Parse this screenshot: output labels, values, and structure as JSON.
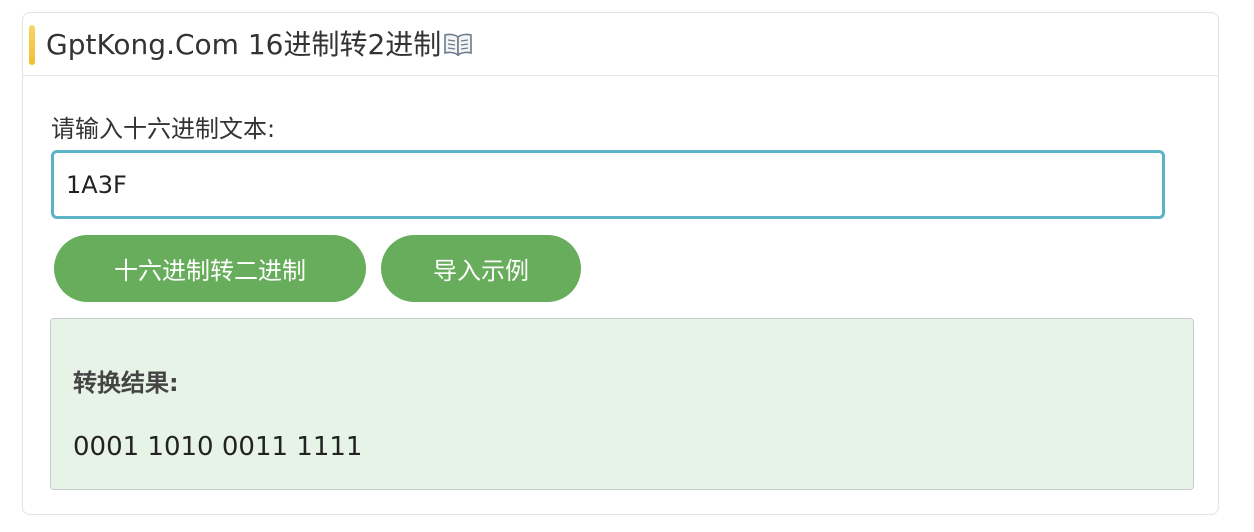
{
  "header": {
    "title": "GptKong.Com 16进制转2进制",
    "title_icon": "open-book-icon",
    "accent_color": "#f0c030"
  },
  "form": {
    "input_label": "请输入十六进制文本:",
    "input_value": "1A3F",
    "input_border_color": "#5cb3c6"
  },
  "buttons": {
    "convert_label": "十六进制转二进制",
    "example_label": "导入示例",
    "color": "#67ad5b"
  },
  "result": {
    "heading": "转换结果:",
    "value": "0001 1010 0011 1111",
    "background_color": "#e8f3e8"
  }
}
